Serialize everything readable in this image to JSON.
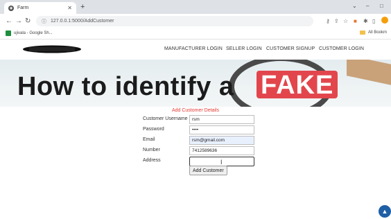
{
  "browser": {
    "tab_title": "Farm",
    "tab_favicon": "globe-icon",
    "new_tab": "+",
    "url": "127.0.0.1:5000/AddCustomer",
    "bookmark": "ujivala - Google Sh...",
    "bookmarks_right": "All Bookm",
    "window_controls": {
      "minimize": "–",
      "maximize": "□",
      "collapse": "⌄"
    }
  },
  "site_nav": {
    "links": [
      "MANUFACTURER LOGIN",
      "SELLER LOGIN",
      "CUSTOMER SIGNUP",
      "CUSTOMER LOGIN"
    ]
  },
  "banner": {
    "headline": "How to identify a",
    "highlight": "FAKE"
  },
  "form": {
    "heading": "Add Customer Details",
    "fields": [
      {
        "label": "Customer Username",
        "value": "rsm"
      },
      {
        "label": "Password",
        "value": "••••"
      },
      {
        "label": "Email",
        "value": "rsm@gmail.com"
      },
      {
        "label": "Number",
        "value": "7412589636"
      },
      {
        "label": "Address",
        "value": ""
      }
    ],
    "submit_label": "Add Customer"
  },
  "colors": {
    "heading_red": "#e53935",
    "fake_red": "#e2464c",
    "scroll_blue": "#1f5fa5"
  }
}
